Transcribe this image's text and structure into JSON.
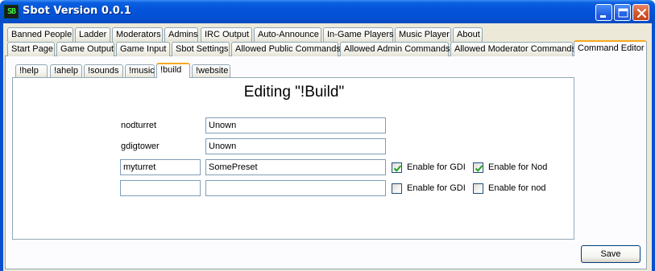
{
  "window": {
    "title": "Sbot Version 0.0.1",
    "icon_text": "SB",
    "icon": "sbot-app-icon",
    "controls": {
      "minimize_icon": "minimize-icon",
      "maximize_icon": "maximize-icon",
      "close_icon": "close-icon"
    }
  },
  "tabs_row1": [
    "Banned People",
    "Ladder",
    "Moderators",
    "Admins",
    "IRC Output",
    "Auto-Announce",
    "In-Game Players",
    "Music Player",
    "About"
  ],
  "tabs_row2": [
    "Start Page",
    "Game Output",
    "Game Input",
    "Sbot Settings",
    "Allowed Public Commands",
    "Allowed Admin Commands",
    "Allowed Moderator Commands",
    "Command Editor"
  ],
  "active_tab": "Command Editor",
  "command_tabs": [
    "!help",
    "!ahelp",
    "!sounds",
    "!music",
    "!build",
    "!website"
  ],
  "active_command_tab": "!build",
  "editor": {
    "heading": "Editing \"!Build\"",
    "rows": [
      {
        "name": "nodturret",
        "value": "Unown"
      },
      {
        "name": "gdigtower",
        "value": "Unown"
      },
      {
        "name": "myturret",
        "value": "SomePreset",
        "gdi_label": "Enable for GDI",
        "gdi_checked": true,
        "nod_label": "Enable for Nod",
        "nod_checked": true
      },
      {
        "name": "",
        "value": "",
        "gdi_label": "Enable for GDI",
        "gdi_checked": false,
        "nod_label": "Enable for nod",
        "nod_checked": false
      }
    ],
    "save_label": "Save"
  },
  "colors": {
    "titlebar": "#0454da",
    "tab_highlight": "#f8a722",
    "check": "#21a121"
  }
}
